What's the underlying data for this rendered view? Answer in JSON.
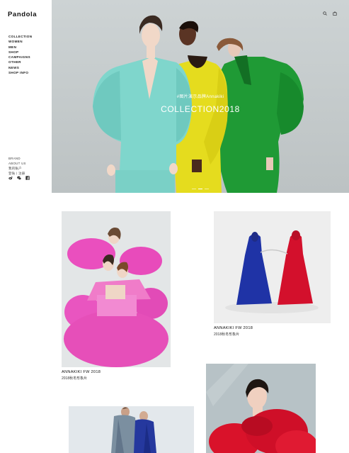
{
  "brand": {
    "logo": "Pandola"
  },
  "nav": {
    "items": [
      "COLLECTION",
      "WOMEN",
      "MEN",
      "SHOP",
      "CAMPAIGNS",
      "OTHER",
      "NEWS",
      "SHOP INFO"
    ]
  },
  "subnav": {
    "items": [
      "BRAND",
      "ABOUT US",
      "我的账户",
      "登陆丨注册"
    ]
  },
  "social": [
    "weibo-icon",
    "wechat-icon",
    "facebook-icon"
  ],
  "header_icons": [
    "search-icon",
    "bag-icon"
  ],
  "hero": {
    "subtitle": "#图片演示品牌Annakiki",
    "title": "COLLECTION2018",
    "slides": 3,
    "active_slide": 1
  },
  "grid": {
    "cards": [
      {
        "title": "ANNAKIKI FW 2018",
        "subtitle": "2018秋冬形象片"
      },
      {
        "title": "ANNAKIKI FW 2018",
        "subtitle": "2018秋冬形象片"
      }
    ]
  },
  "colors": {
    "turquoise": "#7fd6cc",
    "yellow": "#e5dc1e",
    "green": "#1f9a35",
    "pink": "#e64fb9",
    "blue": "#1f33a6",
    "red": "#d3102c"
  }
}
